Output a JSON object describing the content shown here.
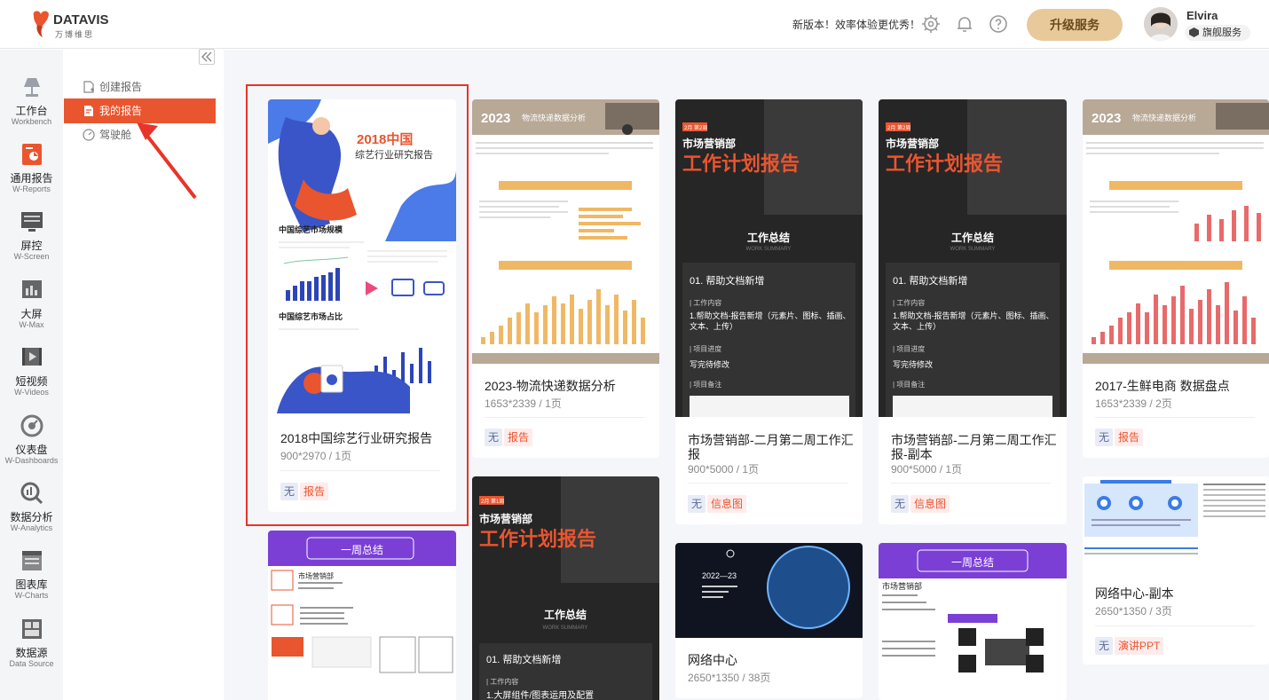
{
  "app": {
    "logo_name": "DATAVIS",
    "logo_sub": "万博维思",
    "notice": "新版本！效率体验更优秀！",
    "upgrade_label": "升级服务",
    "user_name": "Elvira",
    "user_badge": "旗舰服务"
  },
  "leftnav": [
    {
      "cn": "工作台",
      "en": "Workbench",
      "icon": "lamp-icon"
    },
    {
      "cn": "通用报告",
      "en": "W-Reports",
      "icon": "report-icon"
    },
    {
      "cn": "屏控",
      "en": "W-Screen",
      "icon": "screen-control-icon"
    },
    {
      "cn": "大屏",
      "en": "W-Max",
      "icon": "big-screen-icon"
    },
    {
      "cn": "短视频",
      "en": "W-Videos",
      "icon": "video-icon"
    },
    {
      "cn": "仪表盘",
      "en": "W-Dashboards",
      "icon": "dashboard-icon"
    },
    {
      "cn": "数据分析",
      "en": "W-Analytics",
      "icon": "analytics-icon"
    },
    {
      "cn": "图表库",
      "en": "W-Charts",
      "icon": "charts-icon"
    },
    {
      "cn": "数据源",
      "en": "Data Source",
      "icon": "datasource-icon"
    }
  ],
  "subnav": [
    {
      "label": "创建报告",
      "icon": "create-report-icon"
    },
    {
      "label": "我的报告",
      "icon": "my-report-icon"
    },
    {
      "label": "驾驶舱",
      "icon": "cockpit-icon"
    }
  ],
  "thumb_text": {
    "t2018_title": "2018中国",
    "t2018_sub": "综艺行业研究报告",
    "t2018_s1": "中国综艺市场规模",
    "t2018_s2": "中国综艺市场占比",
    "t2023_hero": "2023",
    "t2023_hero_sub": "物流快递数据分析",
    "mkt_tag": "2月 第2周",
    "mkt_tag1": "2月 第1周",
    "mkt_dept": "市场营销部",
    "mkt_title": "工作计划报告",
    "mkt_summary": "工作总结",
    "mkt_summary_en": "WORK SUMMARY",
    "mkt_item": "01. 帮助文档新增",
    "mkt_content": "| 工作内容",
    "mkt_line1": "1.帮助文档-报告新增（元素片、图标、插画、文本、上传）",
    "mkt_line2": "| 项目进度",
    "mkt_line3": "写完待修改",
    "mkt_line4": "| 项目备注",
    "mkt2_line1": "1.大屏组件/图表运用及配置",
    "week_title": "一周总结",
    "week_dept": "市场营销部",
    "net_year": "2022—23",
    "t2017_hero": "2023",
    "t2017_hero_sub": "物流快递数据分析"
  },
  "cards": [
    {
      "title": "2018中国综艺行业研究报告",
      "dims": "900*2970 / 1页",
      "tag_none": "无",
      "tag_type": "报告"
    },
    {
      "title": "2023-物流快递数据分析",
      "dims": "1653*2339 / 1页",
      "tag_none": "无",
      "tag_type": "报告"
    },
    {
      "title": "市场营销部-二月第二周工作汇报",
      "dims": "900*5000 / 1页",
      "tag_none": "无",
      "tag_type": "信息图"
    },
    {
      "title": "市场营销部-二月第二周工作汇报-副本",
      "dims": "900*5000 / 1页",
      "tag_none": "无",
      "tag_type": "信息图"
    },
    {
      "title": "2017-生鲜电商 数据盘点",
      "dims": "1653*2339 / 2页",
      "tag_none": "无",
      "tag_type": "报告"
    },
    {
      "title": "网络中心-副本",
      "dims": "2650*1350 / 3页",
      "tag_none": "无",
      "tag_type": "演讲PPT"
    },
    {
      "title": "网络中心",
      "dims": "2650*1350 / 38页"
    }
  ],
  "colors": {
    "accent": "#e9552f",
    "upgrade_bg": "#e8c99a",
    "highlight": "#e8342a",
    "dark_card": "#2b2b2b",
    "purple": "#7b3fd6"
  }
}
